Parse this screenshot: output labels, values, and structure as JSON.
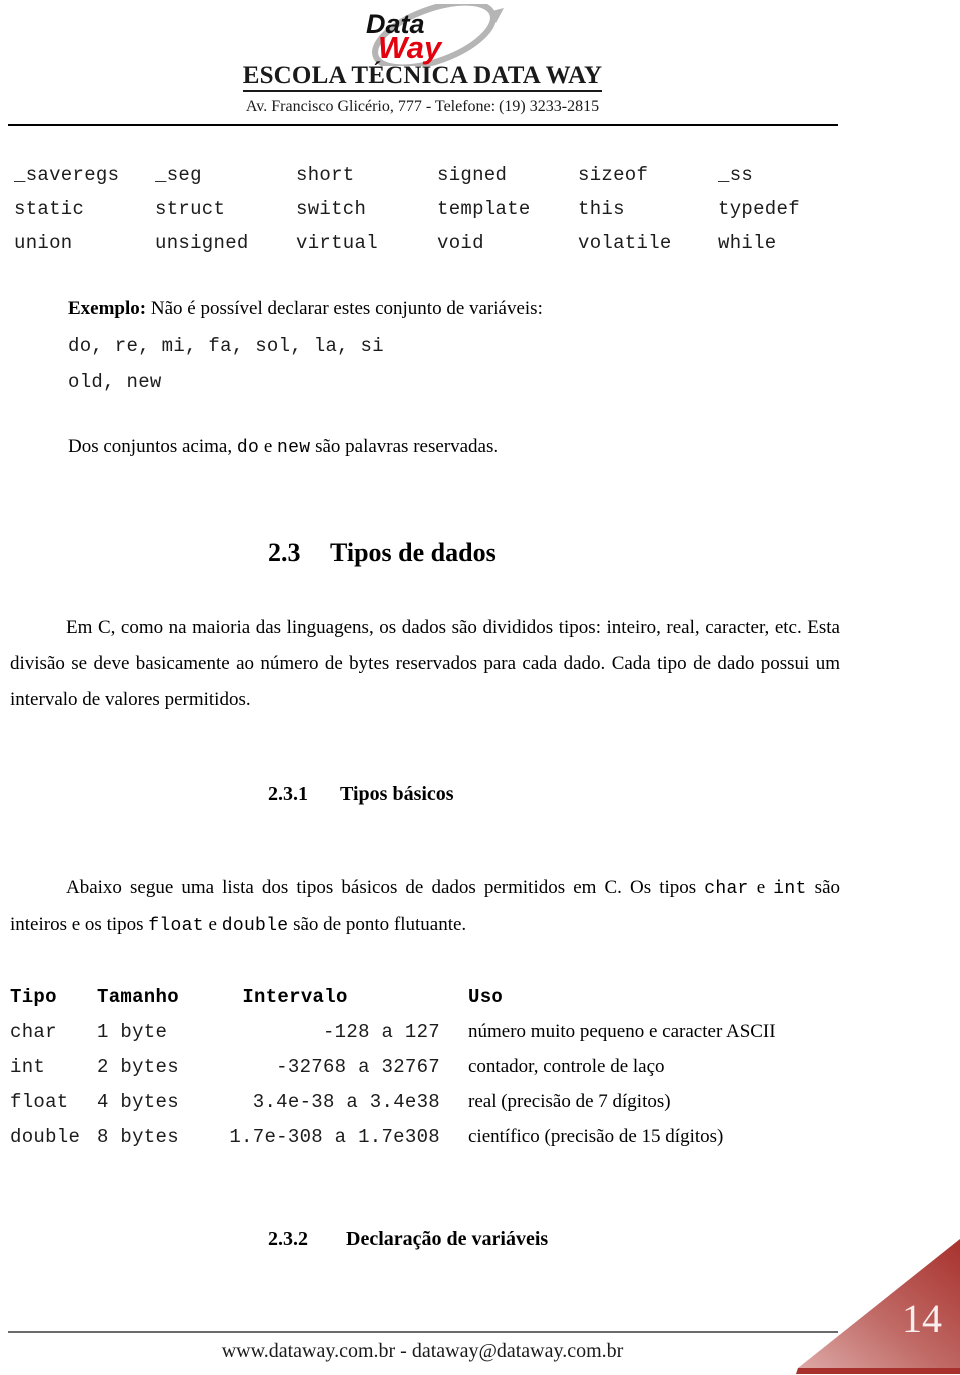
{
  "header": {
    "logo": {
      "word1": "Data",
      "word2": "Way",
      "word1_color": "#111111",
      "word2_color": "#e3000f",
      "swoosh_color": "#b5b5b5"
    },
    "school_name": "ESCOLA TÉCNICA DATA WAY",
    "address": "Av. Francisco Glicério, 777 - Telefone: (19) 3233-2815"
  },
  "keywords": {
    "rows": [
      [
        "_saveregs",
        "_seg",
        "short",
        "signed",
        "sizeof",
        "_ss"
      ],
      [
        "static",
        "struct",
        "switch",
        "template",
        "this",
        "typedef"
      ],
      [
        "union",
        "unsigned",
        "virtual",
        "void",
        "volatile",
        "while"
      ]
    ]
  },
  "example": {
    "label": "Exemplo:",
    "text": " Não é possível declarar estes conjunto de variáveis:",
    "code_line_1": "do, re, mi, fa, sol, la, si",
    "code_line_2": "old, new",
    "note_prefix": "Dos conjuntos acima, ",
    "note_code_1": "do",
    "note_middle": " e ",
    "note_code_2": "new",
    "note_suffix": " são palavras reservadas."
  },
  "section_2_3": {
    "number": "2.3",
    "title": "Tipos de dados",
    "paragraph": "Em C, como na maioria das linguagens, os dados são divididos tipos: inteiro, real, caracter, etc. Esta divisão se deve basicamente ao número de bytes reservados para cada dado. Cada tipo de dado possui um intervalo de valores permitidos."
  },
  "section_2_3_1": {
    "number": "2.3.1",
    "title": "Tipos básicos",
    "para_part_1": "Abaixo segue uma lista dos tipos básicos de dados permitidos em C. Os tipos ",
    "code_char": "char",
    "para_part_2": " e ",
    "code_int": "int",
    "para_part_3": " são inteiros e os tipos ",
    "code_float": "float",
    "para_part_4": " e ",
    "code_double": "double",
    "para_part_5": " são de ponto flutuante."
  },
  "types_table": {
    "headers": [
      "Tipo",
      "Tamanho",
      "Intervalo",
      "Uso"
    ],
    "rows": [
      {
        "tipo": "char",
        "tamanho": "1 byte",
        "intervalo": "-128 a 127",
        "uso": "número muito pequeno e caracter ASCII"
      },
      {
        "tipo": "int",
        "tamanho": "2 bytes",
        "intervalo": "-32768 a 32767",
        "uso": "contador, controle de laço"
      },
      {
        "tipo": "float",
        "tamanho": "4 bytes",
        "intervalo": "3.4e-38 a 3.4e38",
        "uso": "real (precisão de 7 dígitos)"
      },
      {
        "tipo": "double",
        "tamanho": "8 bytes",
        "intervalo": "1.7e-308 a 1.7e308",
        "uso": "científico (precisão de 15 dígitos)"
      }
    ]
  },
  "section_2_3_2": {
    "number": "2.3.2",
    "title": "Declaração de variáveis"
  },
  "footer": {
    "text": "www.dataway.com.br - dataway@dataway.com.br",
    "page_number": "14",
    "corner_color_light": "#d79a97",
    "corner_color_dark": "#a62f2c"
  }
}
